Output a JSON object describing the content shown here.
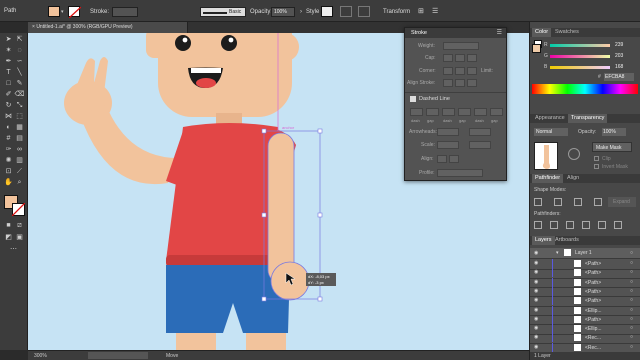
{
  "control_bar": {
    "object_type": "Path",
    "stroke_label": "Stroke:",
    "brush_label": "Basic",
    "opacity_label": "Opacity:",
    "opacity_value": "100%",
    "style_label": "Style",
    "transform_label": "Transform",
    "fill_color": "#F2C39C"
  },
  "document": {
    "tab_title": "Untitled-1.ai* @ 300% (RGB/GPU Preview)"
  },
  "status": {
    "zoom": "300%",
    "tool": "Move"
  },
  "canvas": {
    "measure_tooltip_line1": "dX: -8,03 px",
    "measure_tooltip_line2": "dY: -3 px",
    "anchor_label": "anchor",
    "colors": {
      "background": "#C6E3F4",
      "skin": "#F2C39C",
      "shirt": "#E24646",
      "shirt_shadow": "#C73A3A",
      "shorts": "#2B6CB8",
      "hair": "#6B3B2A",
      "selection": "#7A7AE0",
      "guide": "#D66BD6"
    }
  },
  "stroke_panel": {
    "title": "Stroke",
    "weight_label": "Weight:",
    "cap_label": "Cap:",
    "corner_label": "Corner:",
    "limit_label": "Limit:",
    "align_stroke_label": "Align Stroke:",
    "dashed_line_label": "Dashed Line",
    "dash_labels": [
      "dash",
      "gap",
      "dash",
      "gap",
      "dash",
      "gap"
    ],
    "arrowheads_label": "Arrowheads:",
    "scale_label": "Scale:",
    "align_label": "Align:",
    "profile_label": "Profile:"
  },
  "color_panel": {
    "tabs": [
      "Color",
      "Swatches"
    ],
    "channels": [
      {
        "name": "R",
        "value": "239"
      },
      {
        "name": "G",
        "value": "203"
      },
      {
        "name": "B",
        "value": "168"
      }
    ],
    "hex_label": "#",
    "hex_value": "EFCBA8"
  },
  "transparency_panel": {
    "tabs": [
      "Appearance",
      "Transparency"
    ],
    "blend_mode": "Normal",
    "opacity_label": "Opacity:",
    "opacity_value": "100%",
    "make_mask": "Make Mask",
    "clip": "Clip",
    "invert_mask": "Invert Mask"
  },
  "pathfinder_panel": {
    "tabs": [
      "Pathfinder",
      "Align"
    ],
    "shape_modes_label": "Shape Modes:",
    "expand_label": "Expand",
    "pathfinders_label": "Pathfinders:"
  },
  "layers_panel": {
    "tabs": [
      "Layers",
      "Artboards"
    ],
    "layer_name": "Layer 1",
    "items": [
      "<Path>",
      "<Path>",
      "<Path>",
      "<Path>",
      "<Path>",
      "<Ellip...",
      "<Path>",
      "<Ellip...",
      "<Rec...",
      "<Rec..."
    ],
    "footer": "1 Layer"
  }
}
